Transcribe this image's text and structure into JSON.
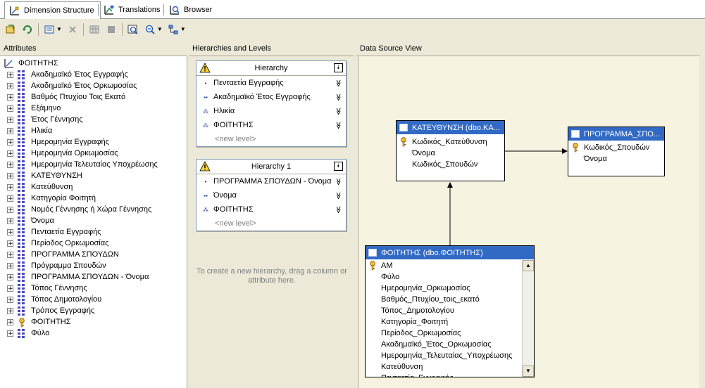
{
  "tabs": [
    {
      "label": "Dimension Structure",
      "active": true
    },
    {
      "label": "Translations",
      "active": false
    },
    {
      "label": "Browser",
      "active": false
    }
  ],
  "panels": {
    "attributes": "Attributes",
    "hierarchies": "Hierarchies and Levels",
    "dsv": "Data Source View"
  },
  "attributes": {
    "root": "ΦΟΙΤΗΤΗΣ",
    "items": [
      "Ακαδημαϊκό Έτος Εγγραφής",
      "Ακαδημαϊκό Έτος Ορκωμοσίας",
      "Βαθμός Πτυχίου Τοις Εκατό",
      "Εξάμηνο",
      "Έτος Γέννησης",
      "Ηλικία",
      "Ημερομηνία Εγγραφής",
      "Ημερομηνία Ορκωμοσίας",
      "Ημερομηνία Τελευταίας Υποχρέωσης",
      "ΚΑΤΕΥΘΥΝΣΗ",
      "Κατεύθυνση",
      "Κατηγορία Φοιτητή",
      "Νομός Γέννησης ή Χώρα Γέννησης",
      "Όνομα",
      "Πενταετία Εγγραφής",
      "Περίοδος Ορκωμοσίας",
      "ΠΡΟΓΡΑΜΜΑ ΣΠΟΥΔΩΝ",
      "Πρόγραμμα Σπουδών",
      "ΠΡΟΓΡΑΜΜΑ ΣΠΟΥΔΩΝ - Όνομα",
      "Τόπος Γέννησης",
      "Τόπος Δημοτολογίου",
      "Τρόπος Εγγραφής",
      "ΦΟΙΤΗΤΗΣ",
      "Φύλο"
    ],
    "key_item_index": 22
  },
  "hierarchies": [
    {
      "title": "Hierarchy",
      "levels": [
        {
          "label": "Πενταετία Εγγραφής",
          "icon": "level-1-icon"
        },
        {
          "label": "Ακαδημαϊκό Έτος Εγγραφής",
          "icon": "level-2-icon"
        },
        {
          "label": "Ηλικία",
          "icon": "level-3-icon"
        },
        {
          "label": "ΦΟΙΤΗΤΗΣ",
          "icon": "level-4-icon"
        }
      ],
      "new_level": "<new level>"
    },
    {
      "title": "Hierarchy 1",
      "levels": [
        {
          "label": "ΠΡΟΓΡΑΜΜΑ ΣΠΟΥΔΩΝ - Όνομα",
          "icon": "level-1-icon"
        },
        {
          "label": "Όνομα",
          "icon": "level-2-icon"
        },
        {
          "label": "ΦΟΙΤΗΤΗΣ",
          "icon": "level-3-icon"
        }
      ],
      "new_level": "<new level>"
    }
  ],
  "hint": "To create a new hierarchy, drag a column or attribute here.",
  "tables": {
    "katefthynsi": {
      "title": "ΚΑΤΕΥΘΥΝΣΗ (dbo.ΚΑ...",
      "columns": [
        "Κωδικός_Κατεύθυνση",
        "Όνομα",
        "Κωδικός_Σπουδών"
      ],
      "keys": [
        0
      ]
    },
    "programma": {
      "title": "ΠΡΟΓΡΑΜΜΑ_ΣΠΟ...",
      "columns": [
        "Κωδικός_Σπουδών",
        "Όνομα"
      ],
      "keys": [
        0
      ]
    },
    "foititis": {
      "title": "ΦΟΙΤΗΤΗΣ (dbo.ΦΟΙΤΗΤΗΣ)",
      "columns": [
        "AM",
        "Φύλο",
        "Ημερομηνία_Ορκωμοσίας",
        "Βαθμός_Πτυχίου_τοις_εκατό",
        "Τόπος_Δημοτολογίου",
        "Κατηγορία_Φοιτητή",
        "Περίοδος_Ορκωμοσίας",
        "Ακαδημαϊκό_Έτος_Ορκωμοσίας",
        "Ημερομηνία_Τελευταίας_Υποχρέωσης",
        "Κατεύθυνση",
        "Πενταετία_Εγγραφής"
      ],
      "keys": [
        0
      ]
    }
  },
  "colors": {
    "table_header": "#316ac5",
    "dsv_bg": "#f7f3e1",
    "chrome": "#ece9d8"
  }
}
